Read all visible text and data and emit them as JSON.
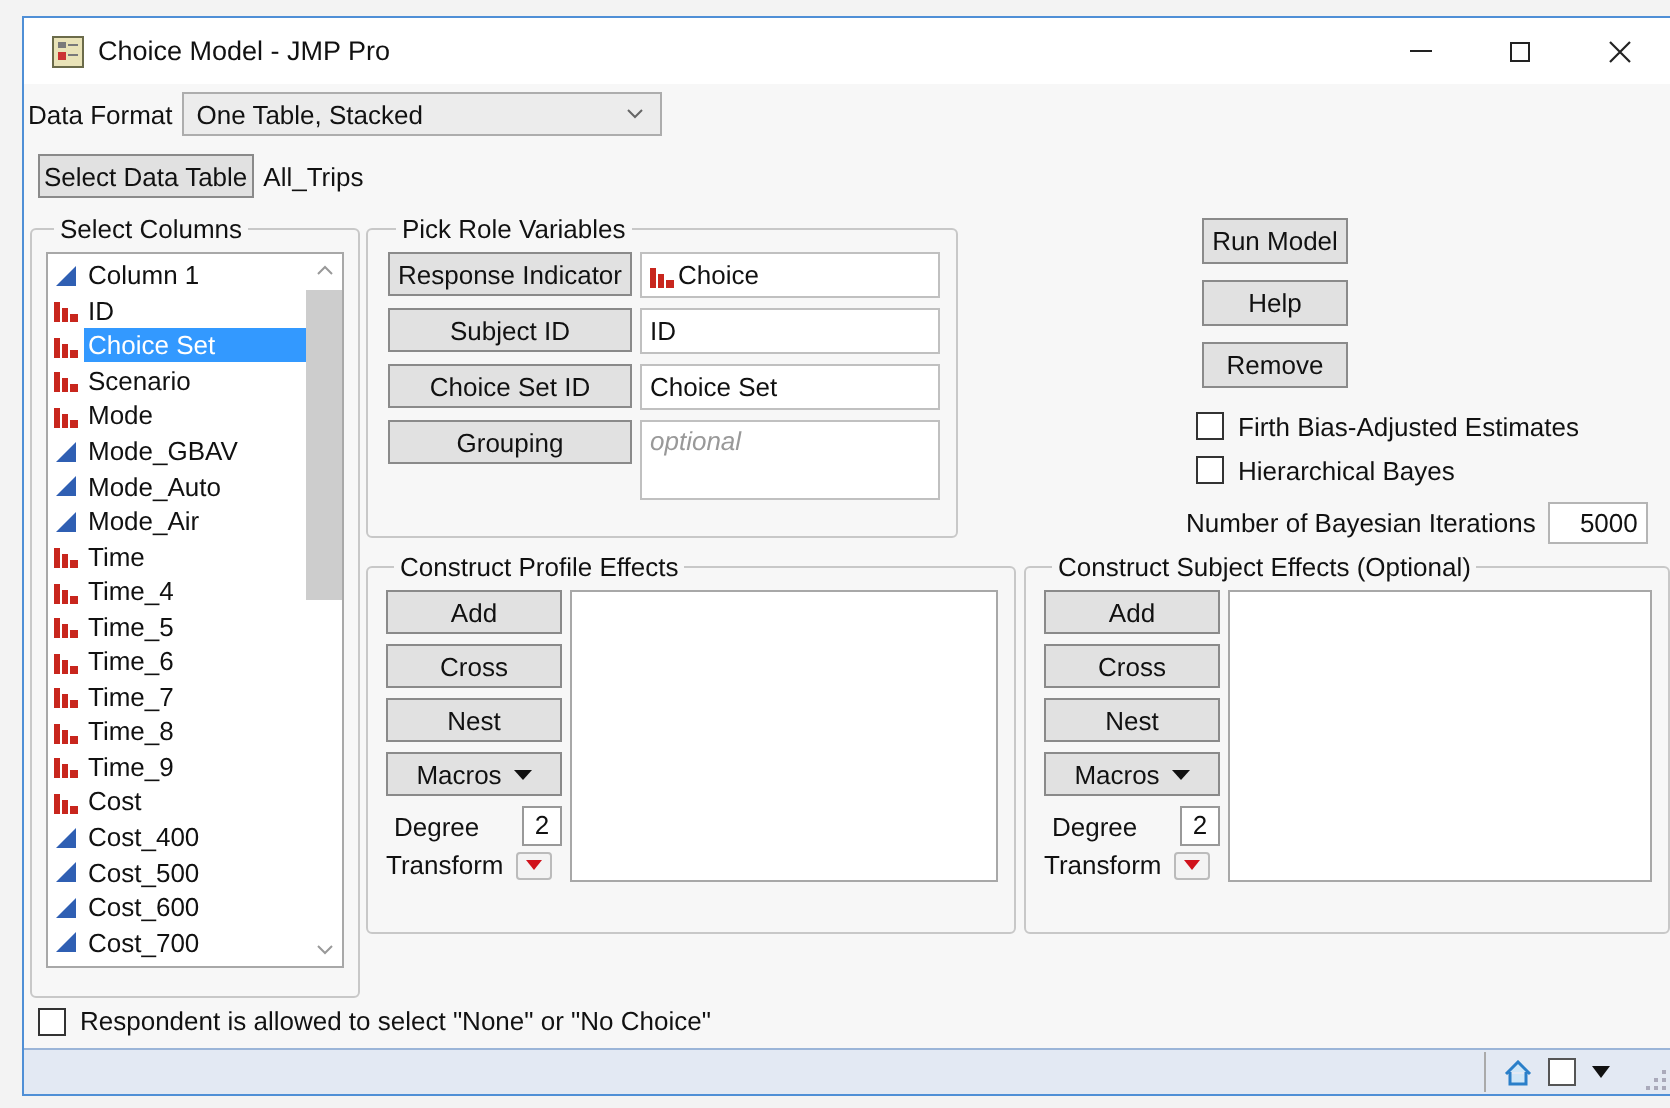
{
  "window": {
    "title": "Choice Model - JMP Pro"
  },
  "data_format": {
    "label": "Data Format",
    "value": "One Table, Stacked"
  },
  "data_table": {
    "button": "Select Data Table",
    "name": "All_Trips"
  },
  "select_columns": {
    "title": "Select Columns",
    "items": [
      {
        "name": "Column 1",
        "kind": "continuous",
        "selected": false
      },
      {
        "name": "ID",
        "kind": "nominal",
        "selected": false
      },
      {
        "name": "Choice Set",
        "kind": "nominal",
        "selected": true
      },
      {
        "name": "Scenario",
        "kind": "nominal",
        "selected": false
      },
      {
        "name": "Mode",
        "kind": "nominal",
        "selected": false
      },
      {
        "name": "Mode_GBAV",
        "kind": "continuous",
        "selected": false
      },
      {
        "name": "Mode_Auto",
        "kind": "continuous",
        "selected": false
      },
      {
        "name": "Mode_Air",
        "kind": "continuous",
        "selected": false
      },
      {
        "name": "Time",
        "kind": "nominal",
        "selected": false
      },
      {
        "name": "Time_4",
        "kind": "nominal",
        "selected": false
      },
      {
        "name": "Time_5",
        "kind": "nominal",
        "selected": false
      },
      {
        "name": "Time_6",
        "kind": "nominal",
        "selected": false
      },
      {
        "name": "Time_7",
        "kind": "nominal",
        "selected": false
      },
      {
        "name": "Time_8",
        "kind": "nominal",
        "selected": false
      },
      {
        "name": "Time_9",
        "kind": "nominal",
        "selected": false
      },
      {
        "name": "Cost",
        "kind": "nominal",
        "selected": false
      },
      {
        "name": "Cost_400",
        "kind": "continuous",
        "selected": false
      },
      {
        "name": "Cost_500",
        "kind": "continuous",
        "selected": false
      },
      {
        "name": "Cost_600",
        "kind": "continuous",
        "selected": false
      },
      {
        "name": "Cost_700",
        "kind": "continuous",
        "selected": false
      }
    ]
  },
  "pick_roles": {
    "title": "Pick Role Variables",
    "roles": [
      {
        "button": "Response Indicator",
        "value": "Choice",
        "kind": "nominal"
      },
      {
        "button": "Subject ID",
        "value": "ID"
      },
      {
        "button": "Choice Set ID",
        "value": "Choice Set"
      },
      {
        "button": "Grouping",
        "placeholder": "optional"
      }
    ]
  },
  "actions": [
    "Run Model",
    "Help",
    "Remove"
  ],
  "options": [
    {
      "label": "Firth Bias-Adjusted Estimates",
      "checked": false
    },
    {
      "label": "Hierarchical Bayes",
      "checked": false
    }
  ],
  "iterations": {
    "label": "Number of Bayesian Iterations",
    "value": "5000"
  },
  "effects_panels": [
    {
      "title": "Construct Profile Effects",
      "buttons": [
        "Add",
        "Cross",
        "Nest"
      ],
      "macros": "Macros",
      "degree_label": "Degree",
      "degree": "2",
      "transform": "Transform"
    },
    {
      "title": "Construct Subject Effects (Optional)",
      "buttons": [
        "Add",
        "Cross",
        "Nest"
      ],
      "macros": "Macros",
      "degree_label": "Degree",
      "degree": "2",
      "transform": "Transform"
    }
  ],
  "none_option": {
    "label": "Respondent is allowed to select \"None\" or \"No Choice\"",
    "checked": false
  }
}
